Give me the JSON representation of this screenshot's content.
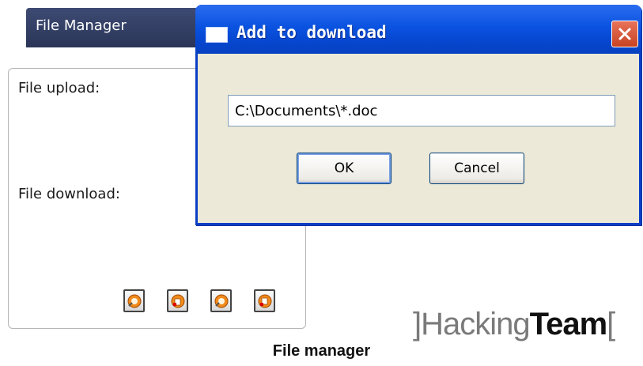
{
  "file_manager": {
    "tab_title": "File Manager",
    "upload_label": "File upload:",
    "download_label": "File download:",
    "tools": [
      {
        "icon": "upload-icon"
      },
      {
        "icon": "add-download-icon"
      },
      {
        "icon": "download-icon"
      },
      {
        "icon": "remove-icon"
      }
    ]
  },
  "dialog": {
    "title": "Add to download",
    "path_value": "C:\\Documents\\*.doc",
    "ok_label": "OK",
    "cancel_label": "Cancel"
  },
  "brand": {
    "part1": "]Hacking",
    "part2": "Team",
    "part3": "["
  },
  "caption": "File manager",
  "colors": {
    "titlebar_blue": "#0a53e0",
    "dialog_bg": "#ece9d8",
    "close_red": "#c74322",
    "icon_orange": "#f08a1a"
  }
}
